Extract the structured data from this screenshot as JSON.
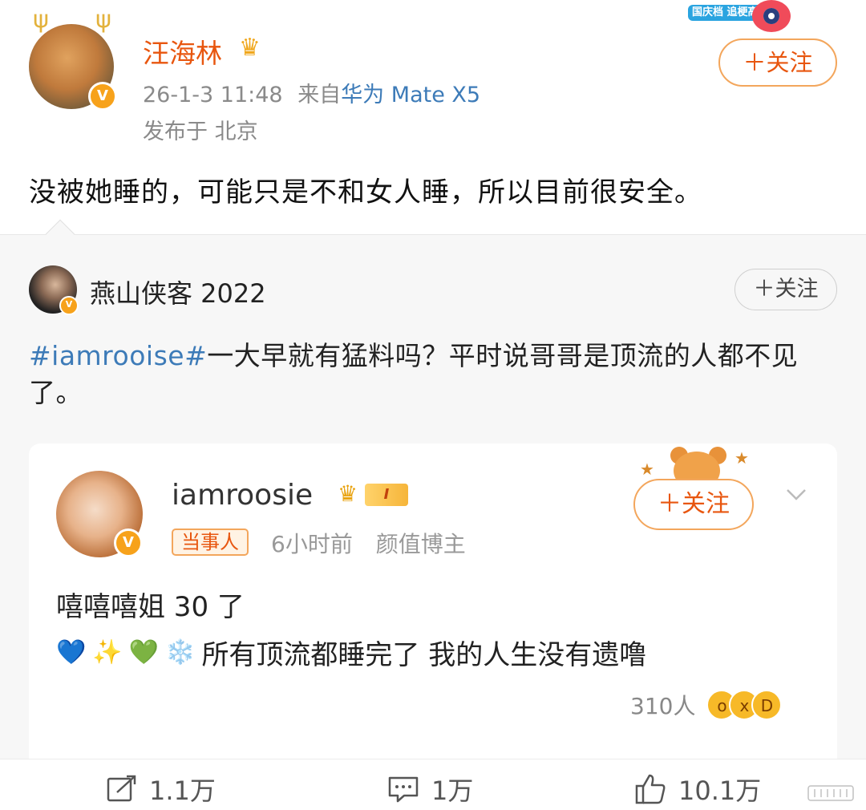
{
  "post": {
    "author": "汪海林",
    "timestamp": "26-1-3 11:48",
    "source_prefix": "来自",
    "device": "华为 Mate X5",
    "location": "发布于 北京",
    "follow_label": "＋关注",
    "promo_badge": "国庆档 追梗高手",
    "text": "没被她睡的，可能只是不和女人睡，所以目前很安全。"
  },
  "repost": {
    "author": "燕山侠客 2022",
    "follow_label": "＋关注",
    "hashtag": "#iamrooise#",
    "text": "一大早就有猛料吗？平时说哥哥是顶流的人都不见了。"
  },
  "quote": {
    "author": "iamroosie",
    "vip_level": "I",
    "tag": "当事人",
    "time": "6小时前",
    "identity": "颜值博主",
    "follow_label": "＋关注",
    "line1": "嘻嘻嘻姐 30 了",
    "emojis": [
      "💙",
      "✨",
      "💚",
      "❄️"
    ],
    "line2": "所有顶流都睡完了 我的人生没有遗噜",
    "reaction_count": "310人"
  },
  "actions": {
    "repost_count": "1.1万",
    "comment_count": "1万",
    "like_count": "10.1万"
  },
  "colors": {
    "accent_orange": "#e8560f",
    "link_blue": "#3d7bb8",
    "follow_border": "#f3a65c"
  }
}
